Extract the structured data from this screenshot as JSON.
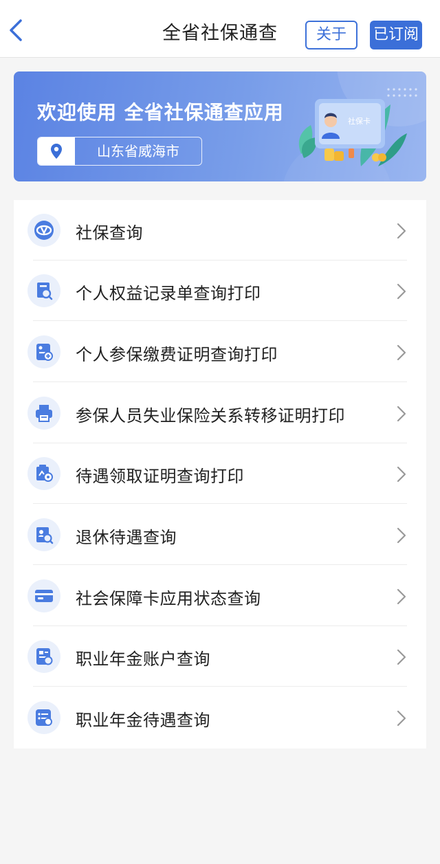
{
  "navbar": {
    "title": "全省社保通查",
    "about_label": "关于",
    "subscribed_label": "已订阅"
  },
  "banner": {
    "title": "欢迎使用 全省社保通查应用",
    "location": "山东省威海市",
    "card_text": "社保卡"
  },
  "menu": {
    "items": [
      {
        "label": "社保查询",
        "icon": "si-logo-icon"
      },
      {
        "label": "个人权益记录单查询打印",
        "icon": "document-search-icon"
      },
      {
        "label": "个人参保缴费证明查询打印",
        "icon": "payment-certificate-icon"
      },
      {
        "label": "参保人员失业保险关系转移证明打印",
        "icon": "printer-icon"
      },
      {
        "label": "待遇领取证明查询打印",
        "icon": "benefit-certificate-icon"
      },
      {
        "label": "退休待遇查询",
        "icon": "retirement-search-icon"
      },
      {
        "label": "社会保障卡应用状态查询",
        "icon": "social-security-card-icon"
      },
      {
        "label": "职业年金账户查询",
        "icon": "annuity-account-icon"
      },
      {
        "label": "职业年金待遇查询",
        "icon": "annuity-benefit-icon"
      }
    ]
  },
  "colors": {
    "accent": "#3b6fd8",
    "icon_blue": "#4a7ce0",
    "icon_bg": "#eaf0fb",
    "page_bg": "#f5f5f5"
  }
}
